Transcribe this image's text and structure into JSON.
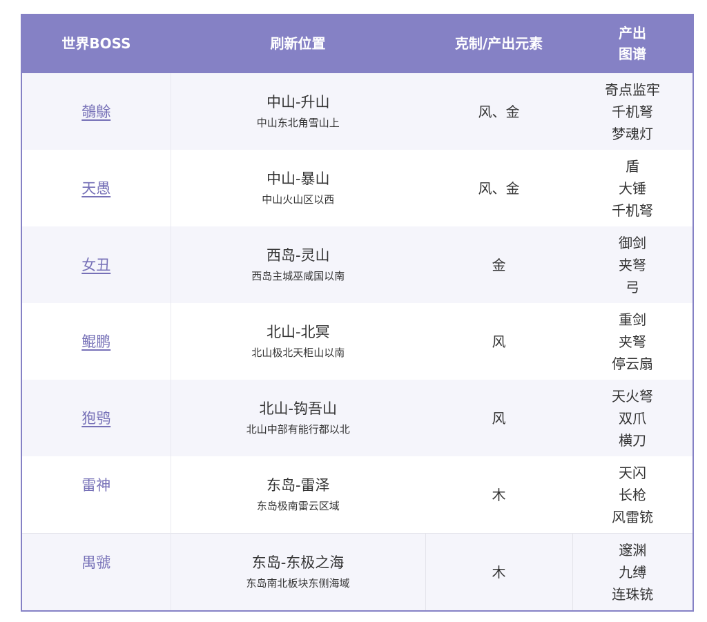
{
  "header": {
    "col_boss": "世界BOSS",
    "col_location": "刷新位置",
    "col_element": "克制/产出元素",
    "col_maps_line1": "产出",
    "col_maps_line2": "图谱"
  },
  "rows": [
    {
      "boss": "鵸鵌",
      "linked": true,
      "loc_main": "中山-升山",
      "loc_sub": "中山东北角雪山上",
      "element": "风、金",
      "maps": [
        "奇点监牢",
        "千机弩",
        "梦魂灯"
      ]
    },
    {
      "boss": "天愚",
      "linked": true,
      "loc_main": "中山-暴山",
      "loc_sub": "中山火山区以西",
      "element": "风、金",
      "maps": [
        "盾",
        "大锤",
        "千机弩"
      ]
    },
    {
      "boss": "女丑",
      "linked": true,
      "loc_main": "西岛-灵山",
      "loc_sub": "西岛主城巫咸国以南",
      "element": "金",
      "maps": [
        "御剑",
        "夹弩",
        "弓"
      ]
    },
    {
      "boss": "鲲鹏",
      "linked": true,
      "loc_main": "北山-北冥",
      "loc_sub": "北山极北天柜山以南",
      "element": "风",
      "maps": [
        "重剑",
        "夹弩",
        "停云扇"
      ]
    },
    {
      "boss": "狍鸮",
      "linked": true,
      "loc_main": "北山-钩吾山",
      "loc_sub": "北山中部有能行都以北",
      "element": "风",
      "maps": [
        "天火弩",
        "双爪",
        "横刀"
      ]
    },
    {
      "boss": "雷神",
      "linked": false,
      "loc_main": "东岛-雷泽",
      "loc_sub": "东岛极南雷云区域",
      "element": "木",
      "maps": [
        "天闪",
        "长枪",
        "风雷铳"
      ]
    },
    {
      "boss": "禺虢",
      "linked": false,
      "loc_main": "东岛-东极之海",
      "loc_sub": "东岛南北板块东侧海域",
      "element": "木",
      "maps": [
        "邃渊",
        "九缚",
        "连珠铳"
      ]
    }
  ]
}
